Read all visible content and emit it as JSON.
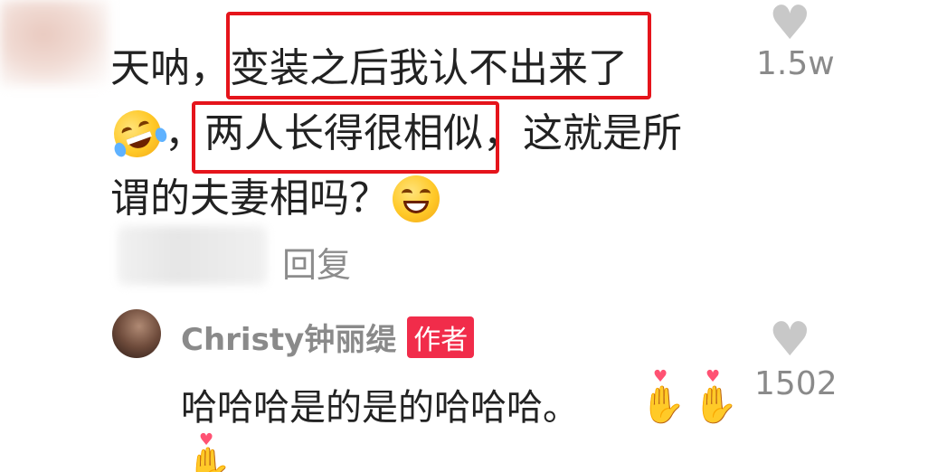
{
  "comment": {
    "line1_prefix": "天呐，",
    "line1_highlight": "变装之后我认不出来了",
    "line2_sep": "，",
    "line2_highlight": "两人长得很相似",
    "line2_suffix": "，这就是所",
    "line3": "谓的夫妻相吗？",
    "like_count": "1.5w",
    "reply_label": "回复"
  },
  "reply": {
    "username": "Christy钟丽缇",
    "badge": "作者",
    "text": "哈哈哈是的是的哈哈哈。",
    "like_count": "1502"
  },
  "icons": {
    "like": "heart-icon",
    "emoji1": "rolling-laughing-emoji",
    "emoji2": "grinning-emoji",
    "finger_heart": "finger-heart-emoji"
  },
  "colors": {
    "highlight_box": "#e5141b",
    "badge": "#f12c4a",
    "muted_text": "#8a8a8a"
  }
}
